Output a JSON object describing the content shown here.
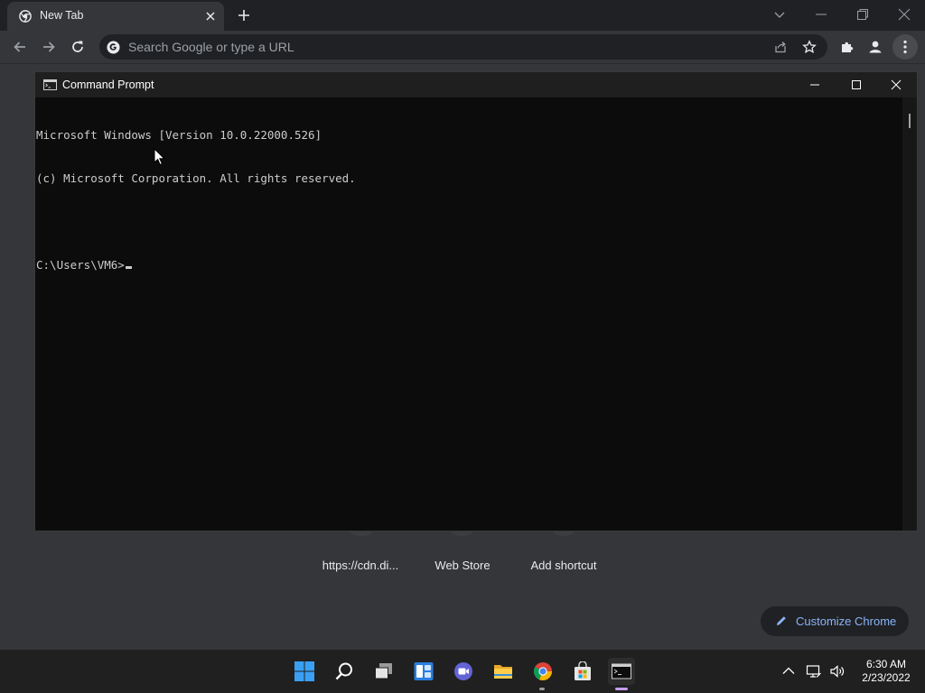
{
  "browser": {
    "tab_title": "New Tab",
    "omnibox_placeholder": "Search Google or type a URL"
  },
  "ntp": {
    "shortcuts": [
      "https://cdn.di...",
      "Web Store",
      "Add shortcut"
    ],
    "customize_label": "Customize Chrome"
  },
  "cmd": {
    "title": "Command Prompt",
    "lines": [
      "Microsoft Windows [Version 10.0.22000.526]",
      "(c) Microsoft Corporation. All rights reserved.",
      "",
      "C:\\Users\\VM6>"
    ]
  },
  "taskbar": {
    "time": "6:30 AM",
    "date": "2/23/2022"
  },
  "colors": {
    "chrome_frame": "#202124",
    "chrome_toolbar": "#35363a",
    "console_bg": "#0c0c0c",
    "console_text": "#cccccc",
    "accent_link": "#8ab4f8",
    "taskbar": "#202020"
  }
}
